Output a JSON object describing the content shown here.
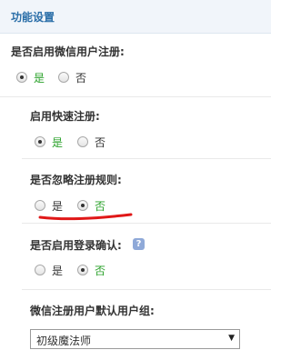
{
  "header": {
    "title": "功能设置"
  },
  "settings": [
    {
      "label": "是否启用微信用户注册:",
      "options": [
        {
          "label": "是",
          "checked": true
        },
        {
          "label": "否",
          "checked": false
        }
      ]
    },
    {
      "label": "启用快速注册:",
      "options": [
        {
          "label": "是",
          "checked": true
        },
        {
          "label": "否",
          "checked": false
        }
      ]
    },
    {
      "label": "是否忽略注册规则:",
      "options": [
        {
          "label": "是",
          "checked": false
        },
        {
          "label": "否",
          "checked": true
        }
      ]
    },
    {
      "label": "是否启用登录确认:",
      "help_icon": "?",
      "options": [
        {
          "label": "是",
          "checked": false
        },
        {
          "label": "否",
          "checked": true
        }
      ]
    }
  ],
  "default_group": {
    "label": "微信注册用户默认用户组:",
    "selected": "初级魔法师"
  },
  "colors": {
    "active_option": "#2aa12a",
    "header_title": "#2a6ea8",
    "annotation_underline": "#e01818"
  },
  "icons": {
    "dropdown": "chevron-down-icon",
    "help": "question-icon"
  }
}
